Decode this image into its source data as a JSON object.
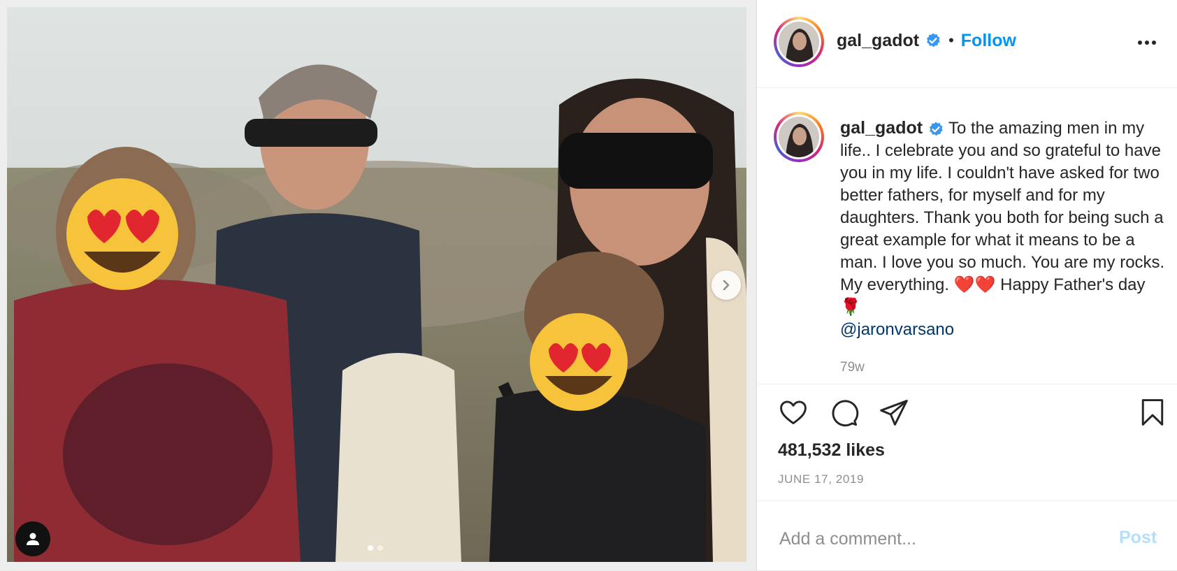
{
  "post": {
    "author": {
      "username": "gal_gadot",
      "verified": true,
      "separator": "•",
      "follow_label": "Follow",
      "avatar": "profile-photo"
    },
    "caption": {
      "username": "gal_gadot",
      "text": "To the amazing men in my life.. I celebrate you and so grateful to have you in my life. I couldn't have asked for two better fathers, for myself and for my daughters. Thank you both for being such a great example for what it means to be a man. I love you so much. You are my rocks. My everything. ❤️❤️ Happy Father's day 🌹",
      "mention": "@jaronvarsano",
      "time_ago": "79w"
    },
    "stats": {
      "likes": "481,532 likes",
      "date": "JUNE 17, 2019"
    },
    "comment": {
      "placeholder": "Add a comment...",
      "post_label": "Post"
    },
    "carousel": {
      "slide_count": 2,
      "current_slide": 1
    },
    "icons": [
      "verified-badge-icon",
      "more-options-icon",
      "heart-icon",
      "comment-icon",
      "share-icon",
      "bookmark-icon",
      "chevron-right-icon",
      "user-tag-icon"
    ],
    "colors": {
      "accent": "#0095f6",
      "verified": "#3897f0",
      "muted": "#8e8e8e",
      "text": "#262626",
      "post_disabled": "#b2dffc"
    }
  }
}
